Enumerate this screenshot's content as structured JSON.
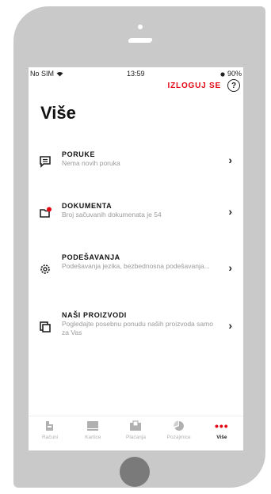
{
  "status_bar": {
    "carrier": "No SIM",
    "time": "13:59",
    "battery": "90%"
  },
  "header": {
    "logout_label": "IZLOGUJ SE",
    "help_symbol": "?"
  },
  "page": {
    "title": "Više"
  },
  "menu": {
    "items": [
      {
        "title": "PORUKE",
        "subtitle": "Nema novih poruka",
        "icon": "message-icon",
        "chevron": "›"
      },
      {
        "title": "DOKUMENTA",
        "subtitle": "Broj sačuvanih dokumenata je 54",
        "icon": "document-icon",
        "chevron": "›"
      },
      {
        "title": "PODEŠAVANJA",
        "subtitle": "Podešavanja jezika, bezbednosna podešavanja...",
        "icon": "settings-icon",
        "chevron": "›"
      },
      {
        "title": "NAŠI PROIZVODI",
        "subtitle": "Pogledajte posebnu ponudu naših proizvoda samo za Vas",
        "icon": "products-icon",
        "chevron": "›"
      }
    ]
  },
  "tabbar": {
    "tabs": [
      {
        "label": "Računi",
        "icon": "accounts-icon"
      },
      {
        "label": "Kartice",
        "icon": "cards-icon"
      },
      {
        "label": "Plaćanja",
        "icon": "payments-icon"
      },
      {
        "label": "Pozajmice",
        "icon": "loans-icon"
      },
      {
        "label": "Više",
        "icon": "more-icon",
        "symbol": "•••",
        "active": true
      }
    ]
  },
  "colors": {
    "accent": "#e30613",
    "shell": "#c9c9c9",
    "home_button": "#7a7a7a"
  }
}
